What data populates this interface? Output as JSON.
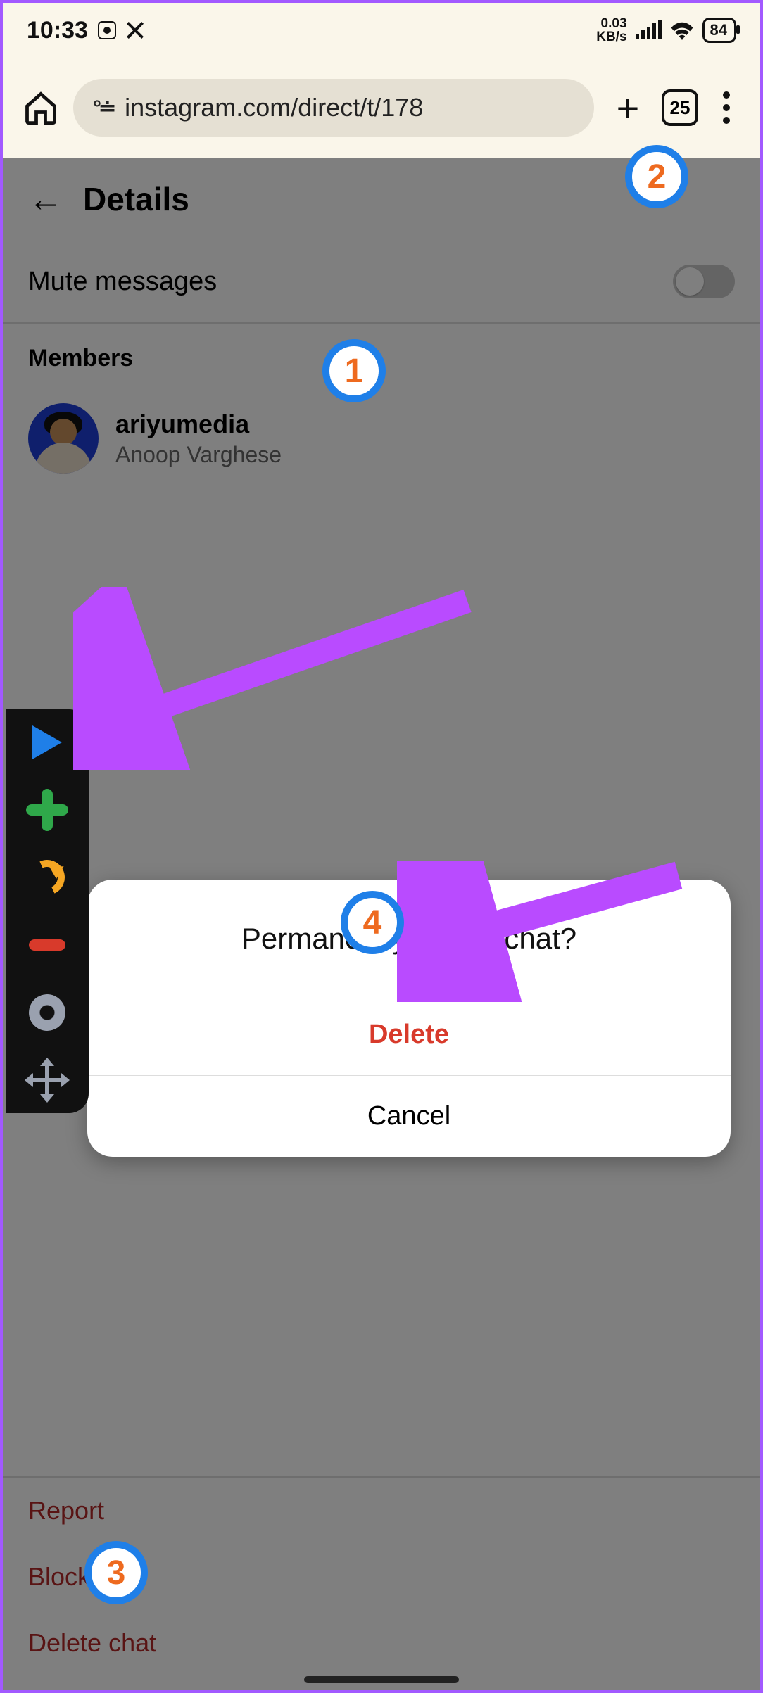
{
  "status": {
    "time": "10:33",
    "kbs_line1": "0.03",
    "kbs_line2": "KB/s",
    "battery": "84"
  },
  "browser": {
    "url": "instagram.com/direct/t/178",
    "tab_count": "25"
  },
  "header": {
    "title": "Details"
  },
  "mute": {
    "label": "Mute messages"
  },
  "members": {
    "heading": "Members",
    "user": {
      "username": "ariyumedia",
      "fullname": "Anoop Varghese"
    }
  },
  "actions": {
    "report": "Report",
    "block": "Block",
    "delete": "Delete chat"
  },
  "dialog": {
    "title": "Permanently delete chat?",
    "delete": "Delete",
    "cancel": "Cancel"
  },
  "badges": {
    "b1": "1",
    "b2": "2",
    "b3": "3",
    "b4": "4"
  }
}
